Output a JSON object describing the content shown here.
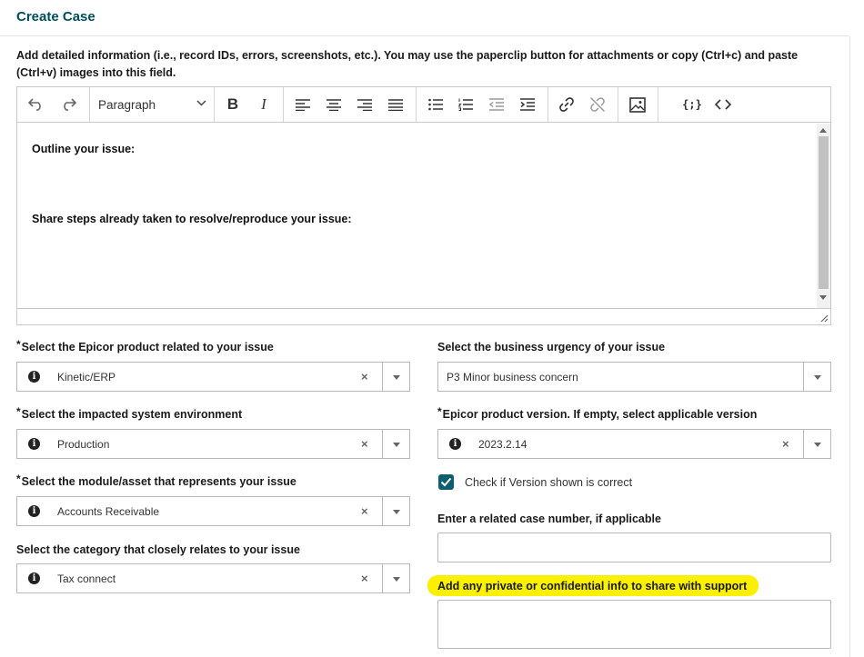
{
  "header": {
    "title": "Create Case"
  },
  "description": "Add detailed information (i.e., record IDs, errors, screenshots, etc.). You may use the paperclip button for attachments or copy (Ctrl+c) and paste (Ctrl+v) images into this field.",
  "editor": {
    "paragraph_style": "Paragraph",
    "line1": "Outline your issue:",
    "line2": "Share steps already taken to resolve/reproduce your issue:",
    "code_sample_label": "{;}"
  },
  "fields": {
    "product": {
      "label": "Select the Epicor product related to your issue",
      "required": "*",
      "value": "Kinetic/ERP"
    },
    "environment": {
      "label": "Select the impacted system environment",
      "required": "*",
      "value": "Production"
    },
    "module": {
      "label": "Select the module/asset that represents your issue",
      "required": "*",
      "value": "Accounts Receivable"
    },
    "category": {
      "label": "Select the category that closely relates to your issue",
      "value": "Tax connect"
    },
    "urgency": {
      "label": "Select the business urgency of your issue",
      "value": "P3 Minor business concern"
    },
    "version": {
      "label": "Epicor product version. If empty, select applicable version",
      "required": "*",
      "value": "2023.2.14"
    },
    "version_check": {
      "label": "Check if Version shown is correct",
      "checked": true
    },
    "related_case": {
      "label": "Enter a related case number, if applicable",
      "value": ""
    },
    "private_info": {
      "label": "Add any private or confidential info to share with support",
      "value": ""
    }
  },
  "colors": {
    "brand": "#004c5a",
    "checkbox": "#0b5f6e",
    "highlight": "#fbf000"
  },
  "icons": [
    "undo-icon",
    "redo-icon",
    "bold-icon",
    "italic-icon",
    "align-left-icon",
    "align-center-icon",
    "align-right-icon",
    "align-justify-icon",
    "bullet-list-icon",
    "numbered-list-icon",
    "outdent-icon",
    "indent-icon",
    "link-icon",
    "unlink-icon",
    "image-icon",
    "code-sample-icon",
    "source-code-icon",
    "info-icon",
    "clear-icon",
    "chevron-down-icon",
    "checkmark-icon"
  ]
}
